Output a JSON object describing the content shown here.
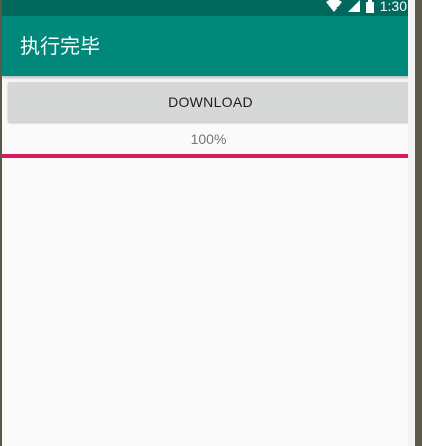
{
  "status_bar": {
    "time": "1:30",
    "icons": [
      "wifi-icon",
      "signal-icon",
      "battery-icon"
    ]
  },
  "toolbar": {
    "title": "执行完毕"
  },
  "download_button": {
    "label": "DOWNLOAD"
  },
  "progress": {
    "text": "100%",
    "value": 1.0
  },
  "colors": {
    "status_bar": "#00695c",
    "toolbar": "#00897b",
    "progress_fill": "#d81b60",
    "button": "#d6d7d7",
    "background": "#fafafa"
  }
}
